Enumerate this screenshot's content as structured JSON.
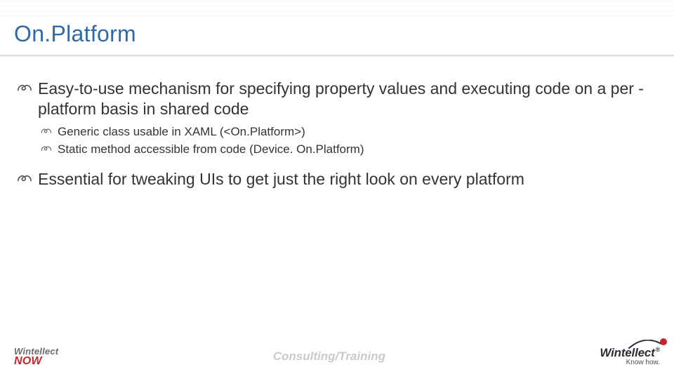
{
  "slide": {
    "title": "On.Platform",
    "bullets": [
      {
        "text": "Easy-to-use mechanism for specifying property values and executing code on a per -platform basis in shared code",
        "sub": [
          "Generic class usable in XAML (<On.Platform>)",
          "Static method accessible from code (Device. On.Platform)"
        ]
      },
      {
        "text": "Essential for tweaking UIs to get just the right look on every platform",
        "sub": []
      }
    ]
  },
  "footer": {
    "left": {
      "line1": "Wintellect",
      "line2": "NOW"
    },
    "center": "Consulting/Training",
    "right": {
      "brand": "Wintellect",
      "reg": "®",
      "tag": "Know how."
    }
  },
  "colors": {
    "title": "#2f6aa6",
    "accentRed": "#c1272d",
    "body": "#333333"
  }
}
